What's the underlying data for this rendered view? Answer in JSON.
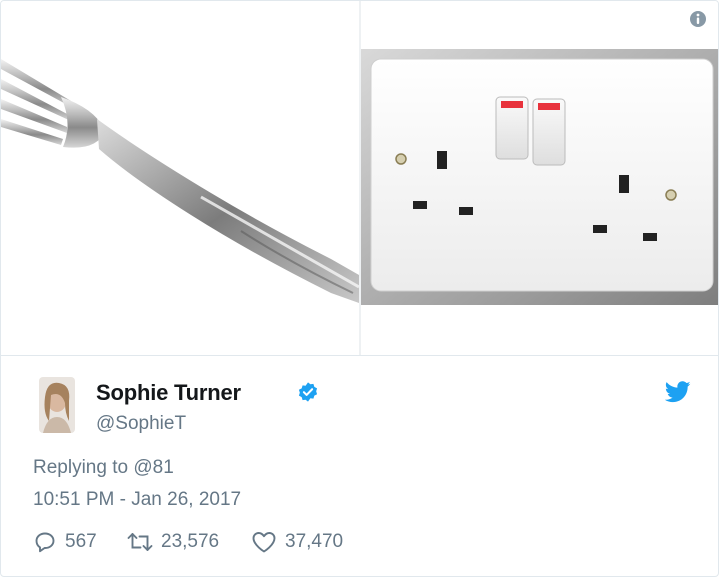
{
  "media": {
    "left_image": "fork-photo",
    "right_image": "uk-double-socket-photo"
  },
  "author": {
    "name": "Sophie Turner",
    "handle": "@SophieT",
    "verified": true,
    "avatar": "profile-photo"
  },
  "tweet": {
    "replying_label": "Replying to",
    "replying_to": "@81",
    "timestamp": "10:51 PM - Jan 26, 2017"
  },
  "actions": {
    "replies": "567",
    "retweets": "23,576",
    "likes": "37,470"
  },
  "colors": {
    "twitter_blue": "#1da1f2",
    "text_primary": "#14171a",
    "text_secondary": "#657786",
    "border": "#e1e8ed",
    "socket_switch_red": "#e8323c"
  },
  "icons": [
    "info-icon",
    "verified-badge-icon",
    "twitter-bird-icon",
    "reply-icon",
    "retweet-icon",
    "like-icon"
  ]
}
